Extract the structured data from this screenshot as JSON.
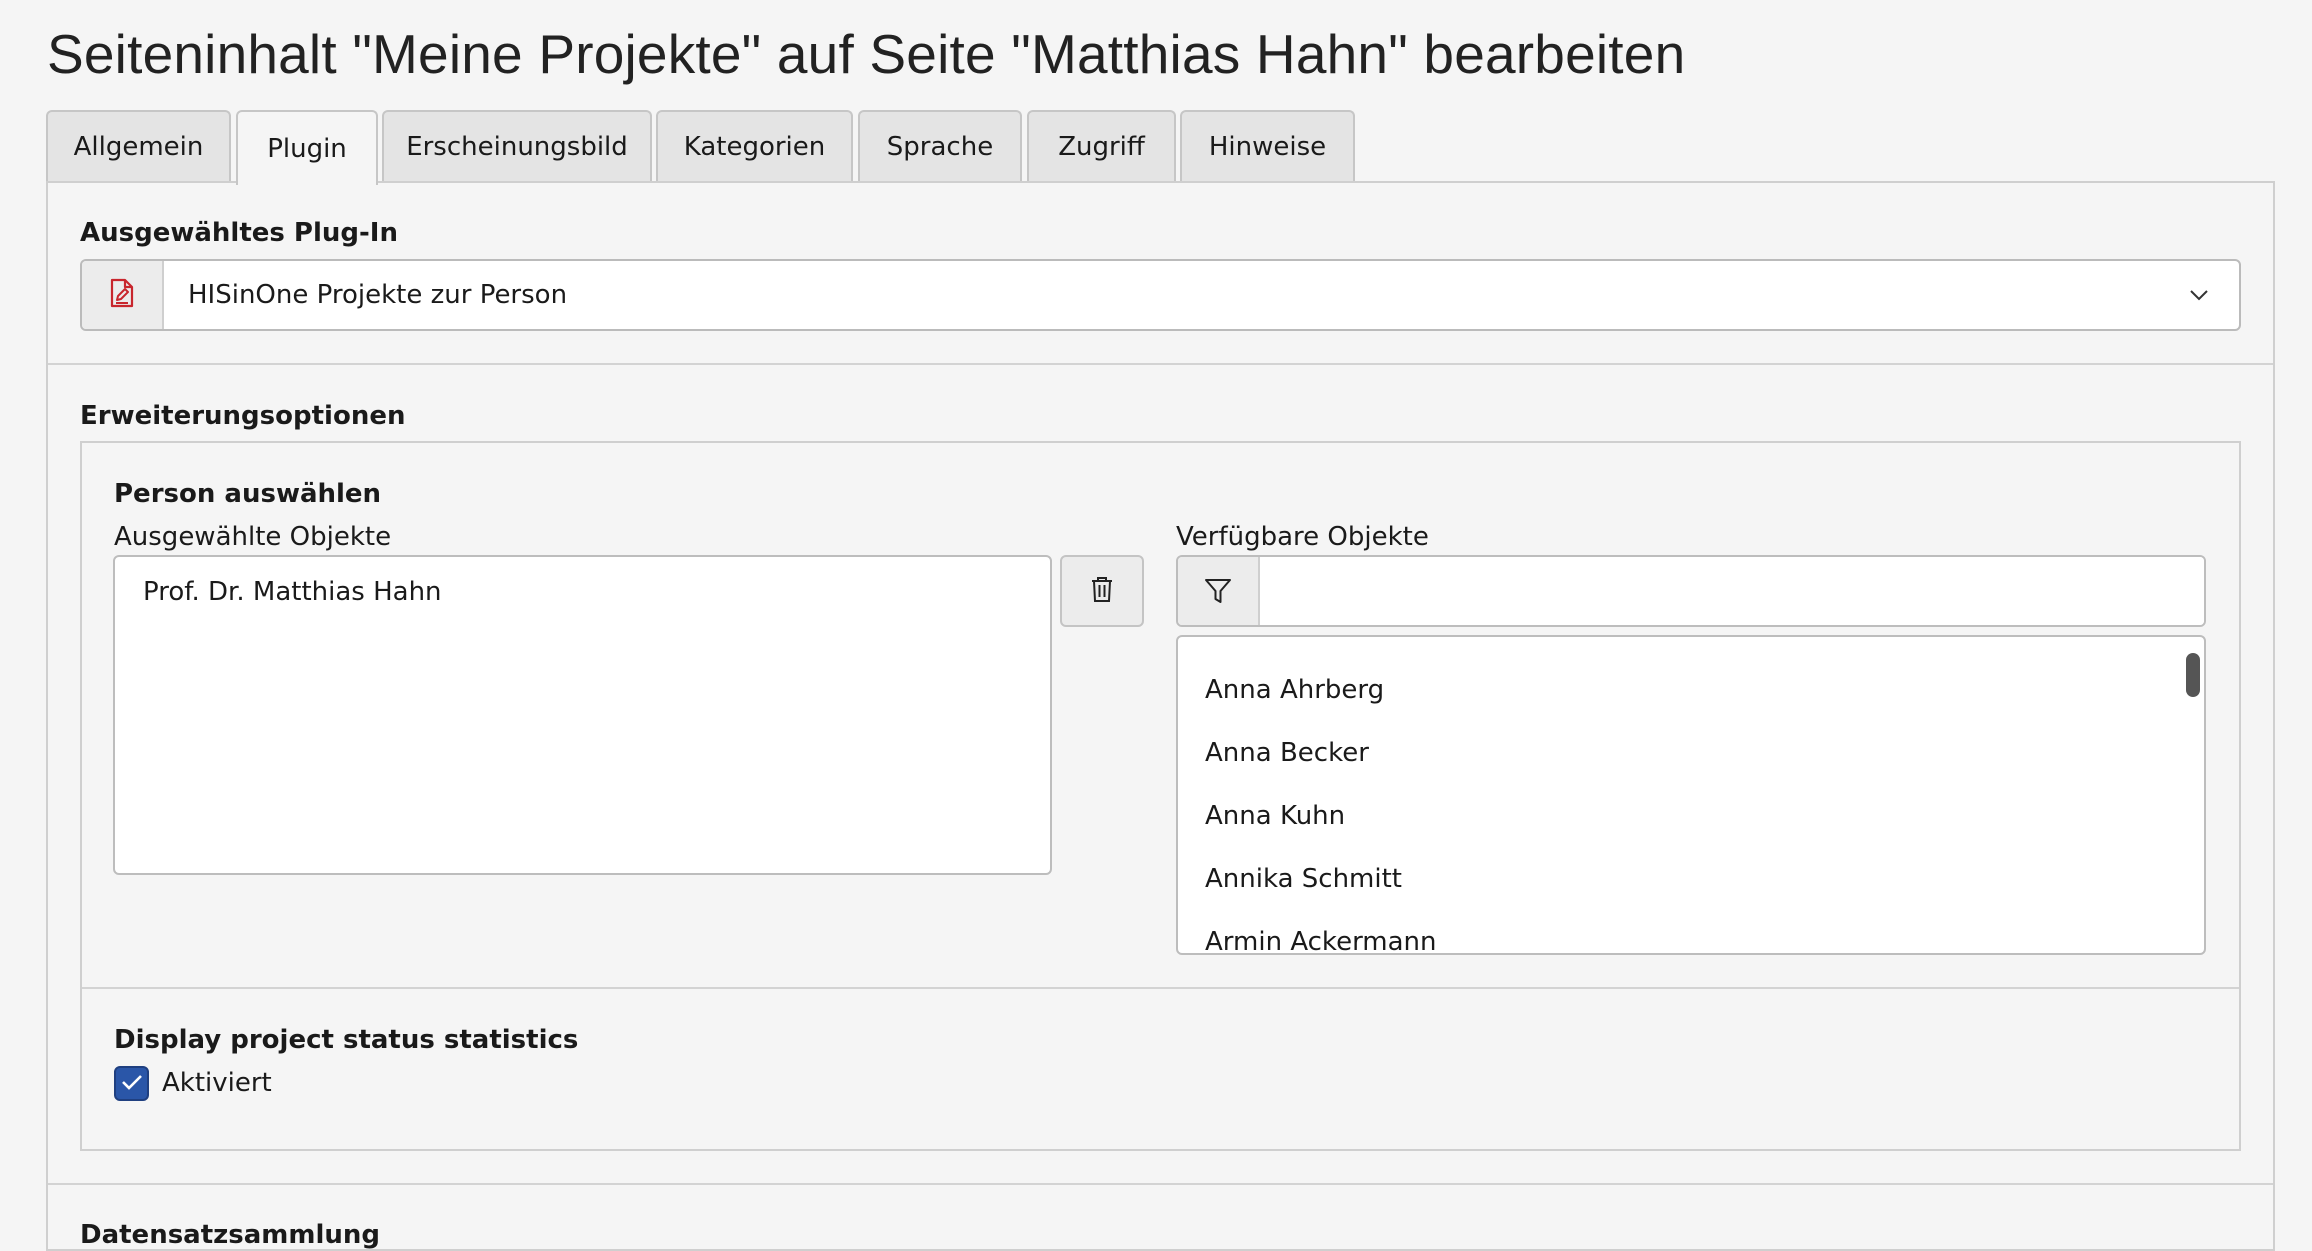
{
  "page": {
    "title": "Seiteninhalt \"Meine Projekte\" auf Seite \"Matthias Hahn\" bearbeiten"
  },
  "tabs": [
    {
      "label": "Allgemein",
      "active": false
    },
    {
      "label": "Plugin",
      "active": true
    },
    {
      "label": "Erscheinungsbild",
      "active": false
    },
    {
      "label": "Kategorien",
      "active": false
    },
    {
      "label": "Sprache",
      "active": false
    },
    {
      "label": "Zugriff",
      "active": false
    },
    {
      "label": "Hinweise",
      "active": false
    }
  ],
  "plugin": {
    "label": "Ausgewähltes Plug-In",
    "selected_value": "HISinOne Projekte zur Person",
    "icon": "plugin-document-icon"
  },
  "extension": {
    "label": "Erweiterungsoptionen",
    "person": {
      "label": "Person auswählen",
      "selected_label": "Ausgewählte Objekte",
      "selected_items": [
        "Prof. Dr. Matthias Hahn"
      ],
      "available_label": "Verfügbare Objekte",
      "filter_value": "",
      "available_items": [
        "Anna Ahrberg",
        "Anna Becker",
        "Anna Kuhn",
        "Annika Schmitt",
        "Armin Ackermann"
      ]
    },
    "stats": {
      "label": "Display project status statistics",
      "checkbox_label": "Aktiviert",
      "checked": true
    }
  },
  "next_section": {
    "label": "Datensatzsammlung"
  },
  "colors": {
    "accent": "#2a56a8",
    "plugin_icon": "#c8262d"
  }
}
